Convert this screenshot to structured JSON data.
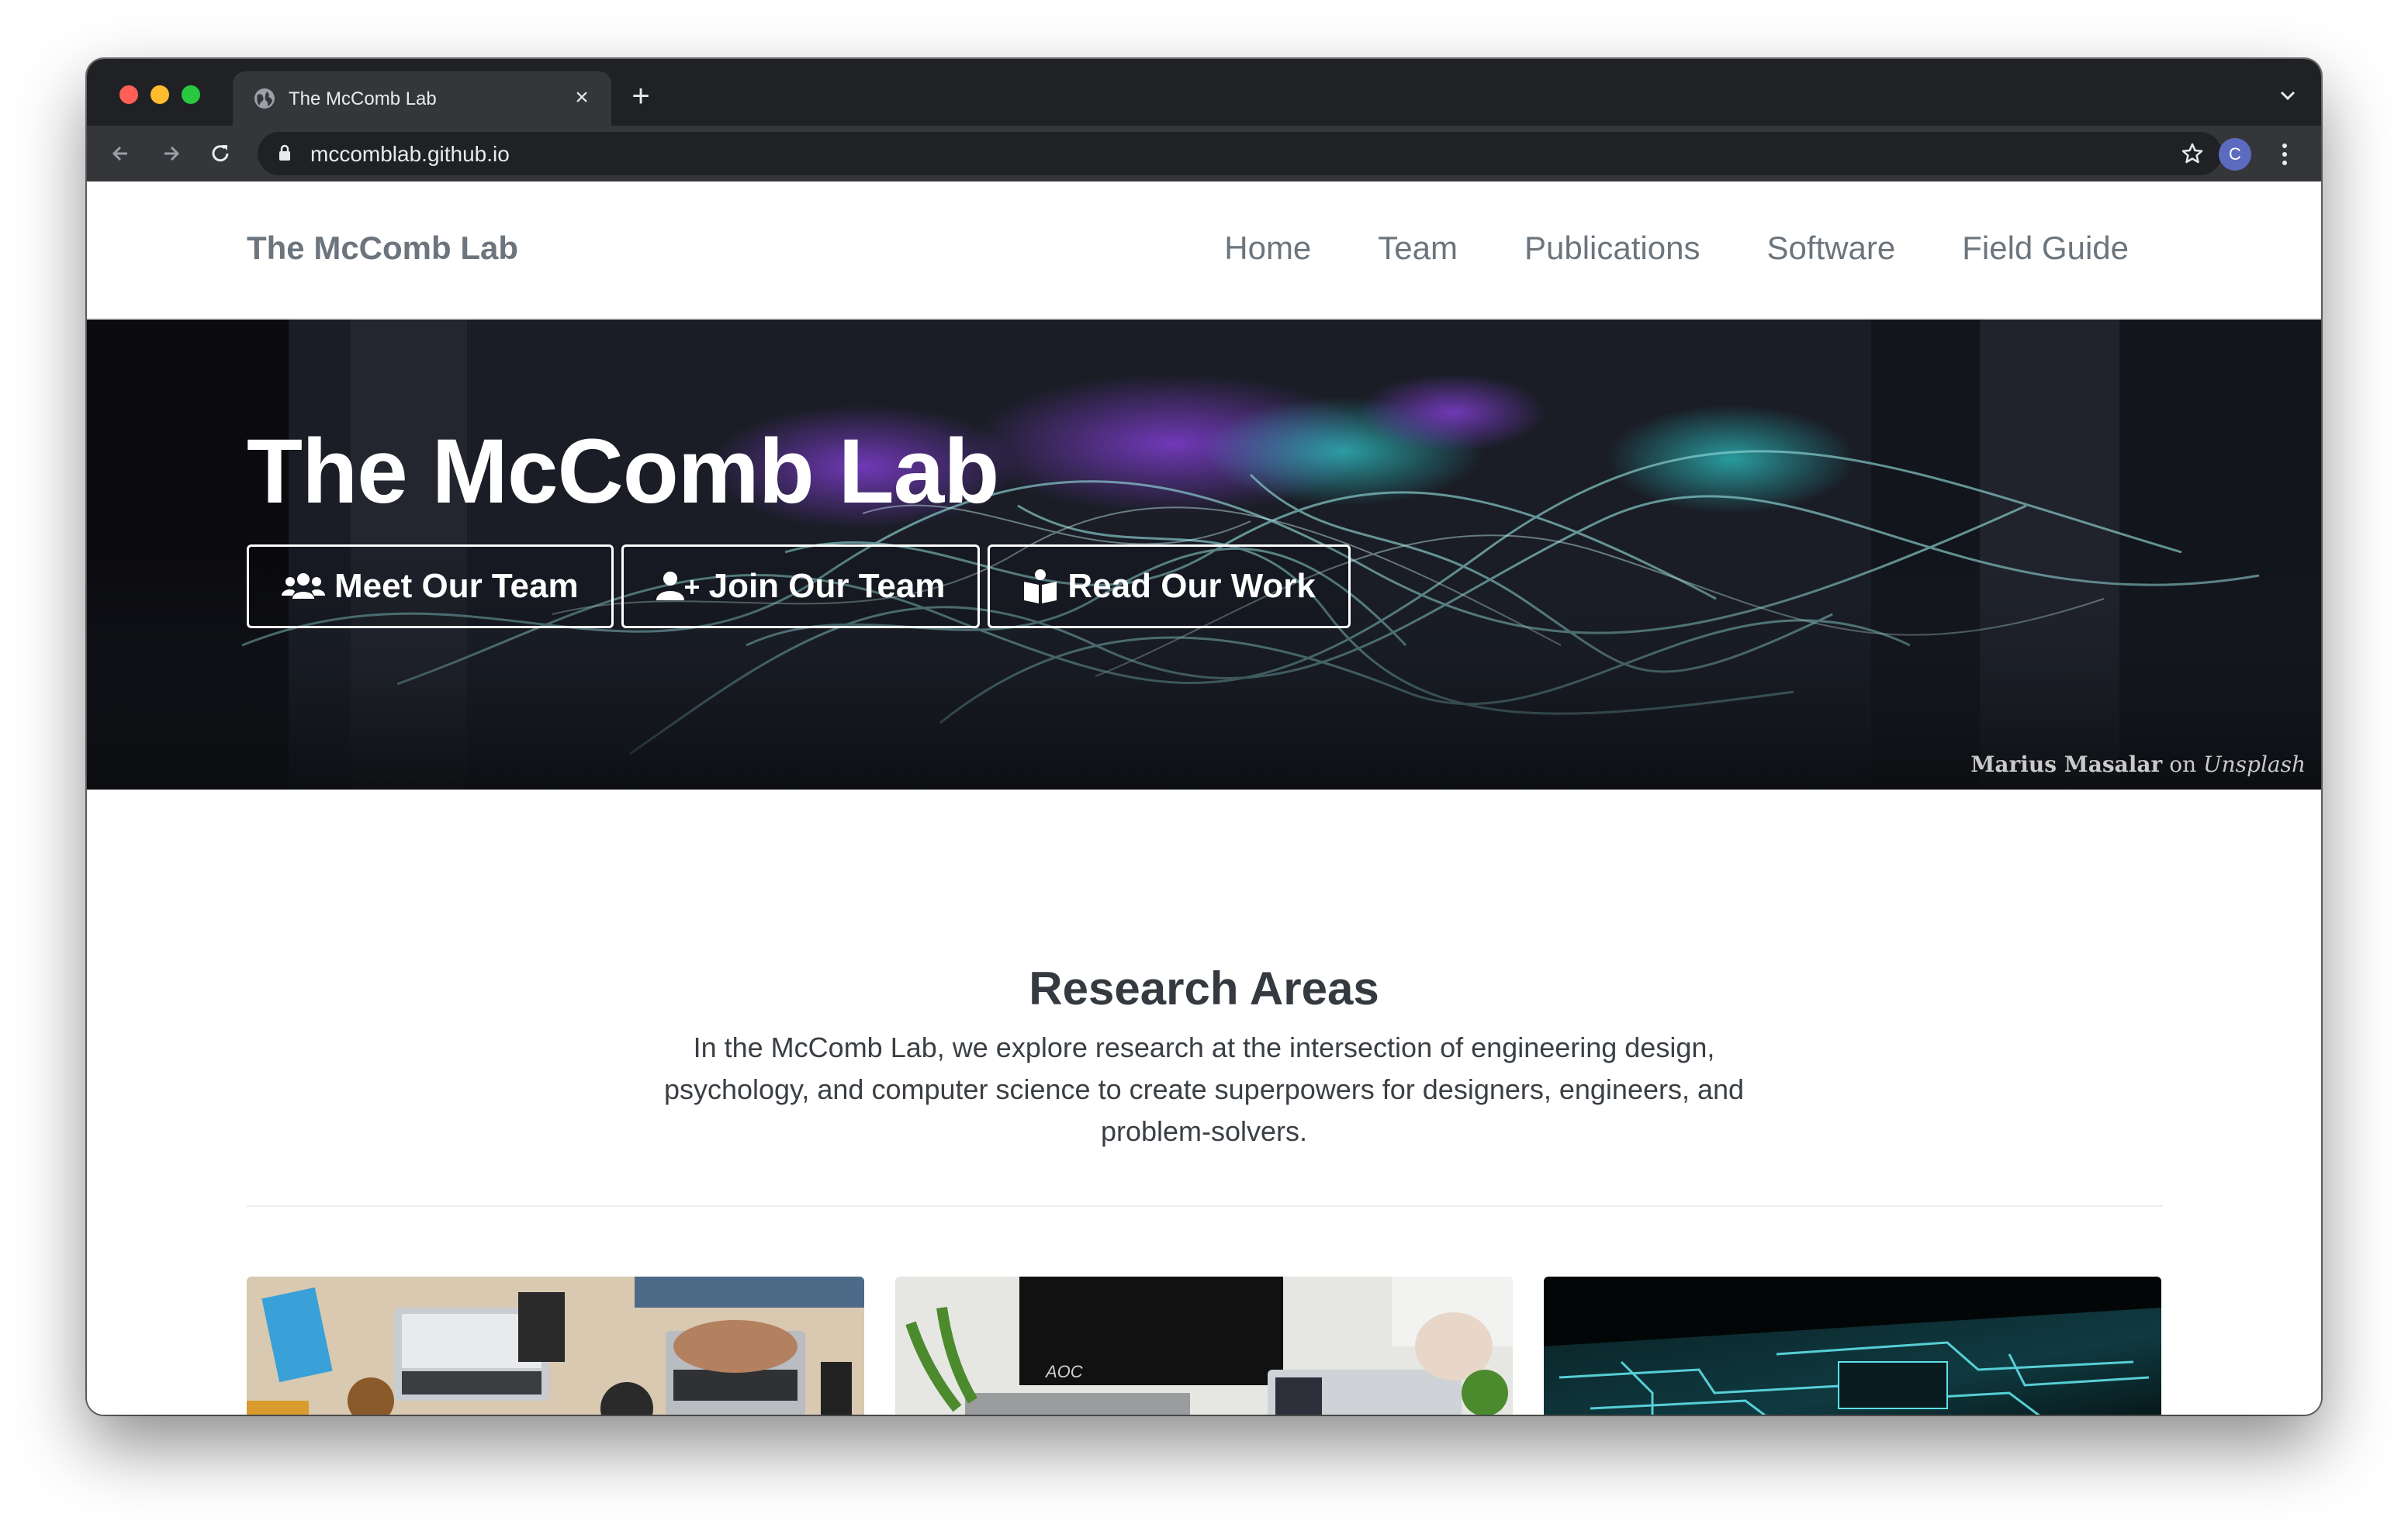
{
  "browser": {
    "tab_title": "The McComb Lab",
    "tab_close": "×",
    "new_tab": "+",
    "url": "mccomblab.github.io",
    "avatar_letter": "C"
  },
  "navbar": {
    "brand": "The McComb Lab",
    "links": [
      "Home",
      "Team",
      "Publications",
      "Software",
      "Field Guide"
    ]
  },
  "hero": {
    "title": "The McComb Lab",
    "buttons": {
      "meet": "Meet Our Team",
      "join": "Join Our Team",
      "read": "Read Our Work"
    },
    "credit_author": "Marius Masalar",
    "credit_on": "on",
    "credit_source": "Unsplash"
  },
  "research": {
    "title": "Research Areas",
    "text": "In the McComb Lab, we explore research at the intersection of engineering design, psychology, and computer science to create superpowers for designers, engineers, and problem-solvers."
  },
  "colors": {
    "chrome_dark": "#202124",
    "chrome_toolbar": "#35363a",
    "nav_text": "#6c757d",
    "heading_text": "#343a40"
  }
}
